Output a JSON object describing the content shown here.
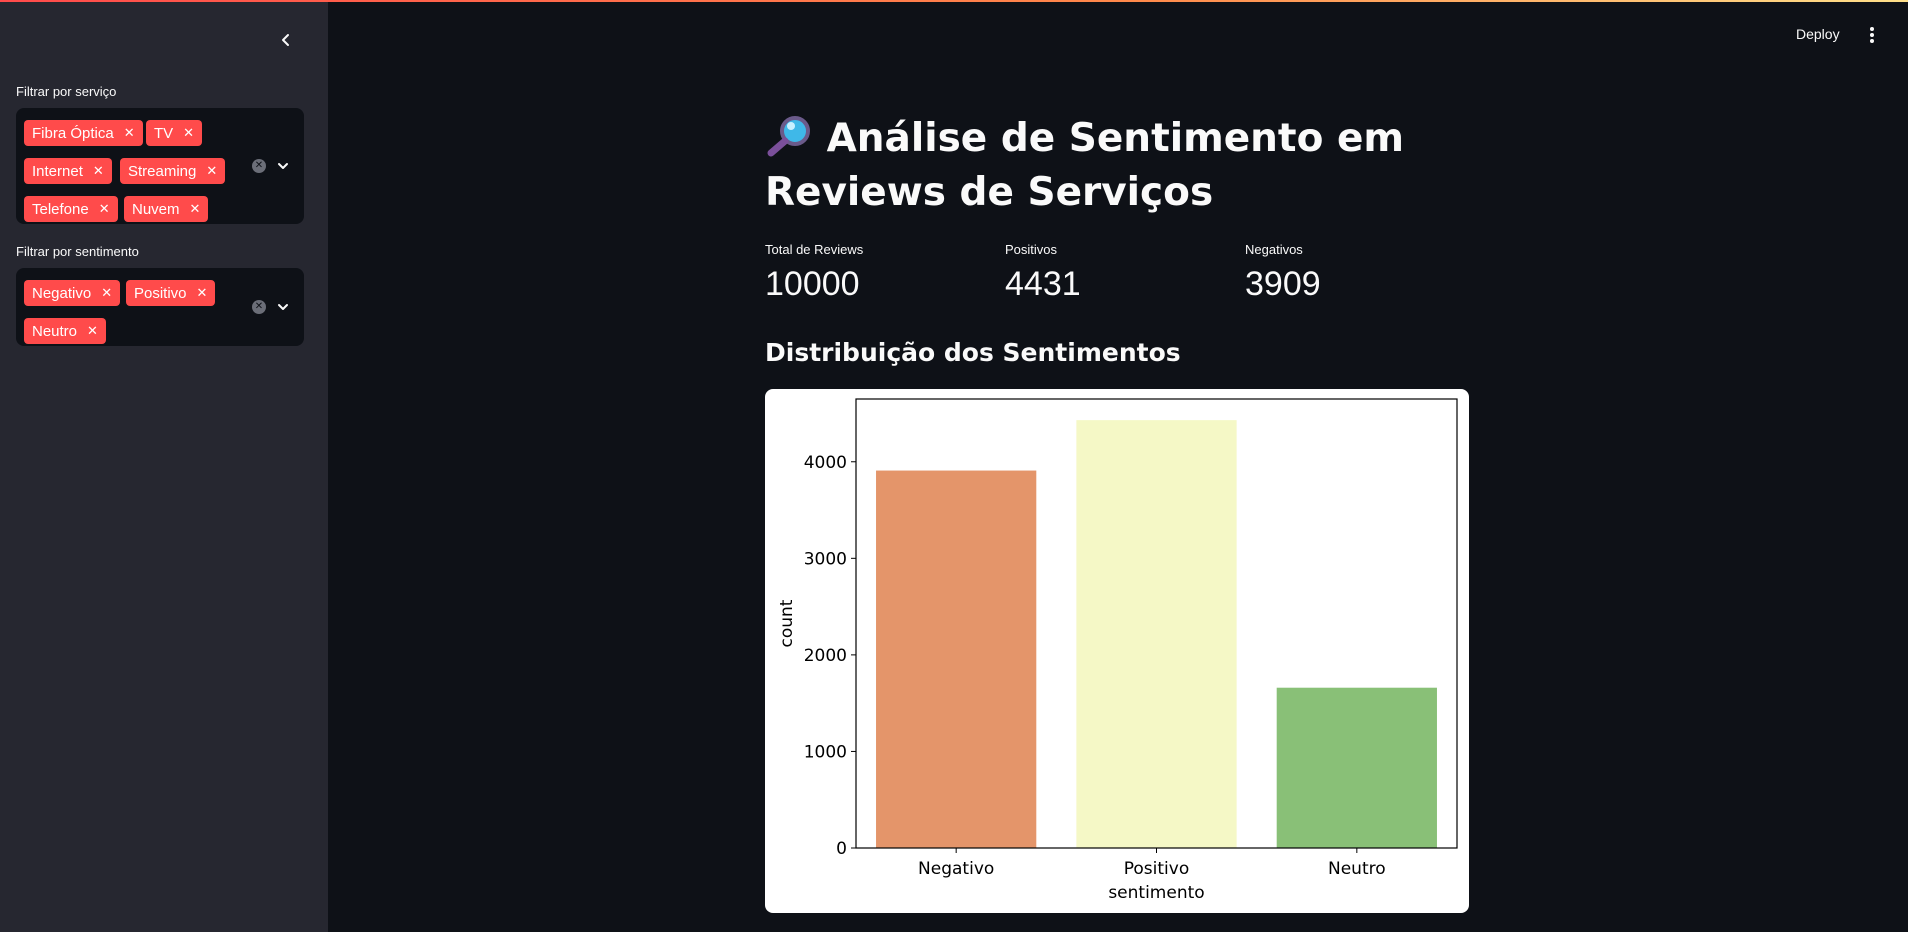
{
  "header": {
    "deploy_label": "Deploy"
  },
  "sidebar": {
    "service_filter": {
      "label": "Filtrar por serviço",
      "selected": [
        "Fibra Óptica",
        "TV",
        "Internet",
        "Streaming",
        "Telefone",
        "Nuvem"
      ]
    },
    "sentiment_filter": {
      "label": "Filtrar por sentimento",
      "selected": [
        "Negativo",
        "Positivo",
        "Neutro"
      ]
    }
  },
  "main": {
    "title": "Análise de Sentimento em Reviews de Serviços",
    "title_icon": "magnifying-glass-icon",
    "metrics": [
      {
        "label": "Total de Reviews",
        "value": "10000"
      },
      {
        "label": "Positivos",
        "value": "4431"
      },
      {
        "label": "Negativos",
        "value": "3909"
      }
    ],
    "section_heading": "Distribuição dos Sentimentos"
  },
  "colors": {
    "accent": "#ff4b4b",
    "background": "#0e1117",
    "sidebar": "#262730"
  },
  "chart_data": {
    "type": "bar",
    "categories": [
      "Negativo",
      "Positivo",
      "Neutro"
    ],
    "values": [
      3909,
      4431,
      1660
    ],
    "colors": [
      "#e4956a",
      "#f5f8c6",
      "#89c077"
    ],
    "xlabel": "sentimento",
    "ylabel": "count",
    "ylim": [
      0,
      4650
    ],
    "yticks": [
      0,
      1000,
      2000,
      3000,
      4000
    ],
    "grid": false
  }
}
